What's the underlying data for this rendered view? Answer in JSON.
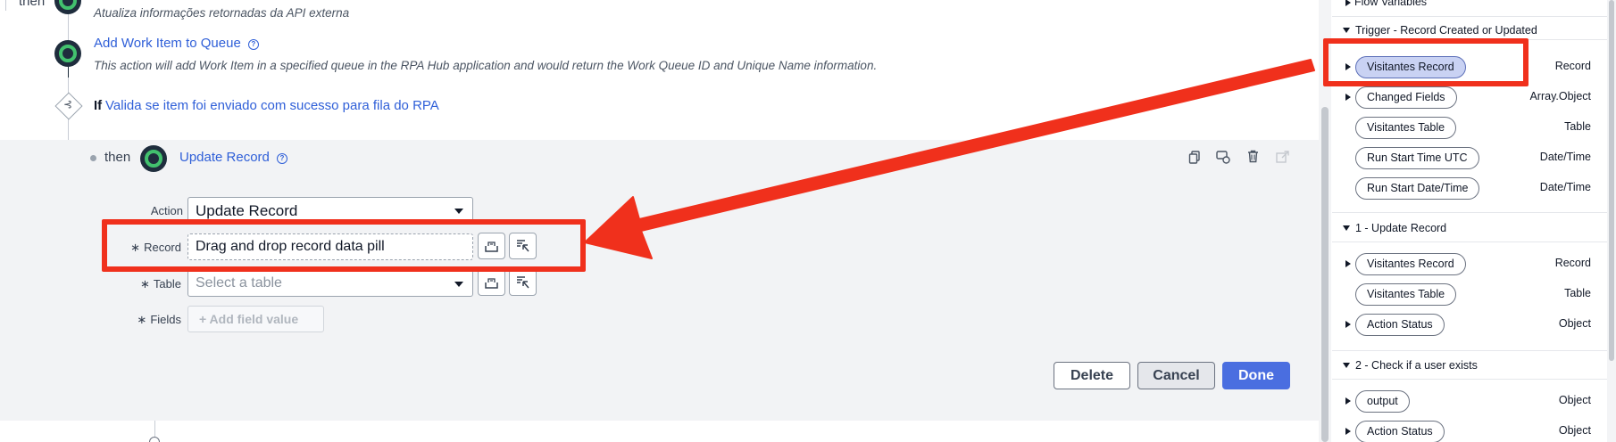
{
  "flow": {
    "top_then_label": "then",
    "top_desc": "Atualiza informações retornadas da API externa",
    "step_add_work_item": {
      "title": "Add Work Item to Queue",
      "desc": "This action will add Work Item in a specified queue in the RPA Hub application and would return the Work Queue ID and Unique Name information."
    },
    "if_step": {
      "keyword": "If",
      "condition": "Valida se item foi enviado com sucesso para fila do RPA"
    },
    "update_step": {
      "then_label": "then",
      "title": "Update Record",
      "toolbar_icons": [
        "copy-icon",
        "comment-icon",
        "trash-icon",
        "open-external-icon"
      ],
      "fields": {
        "action_label": "Action",
        "action_value": "Update Record",
        "record_label": "Record",
        "record_placeholder": "Drag and drop record data pill",
        "table_label": "Table",
        "table_placeholder": "Select a table",
        "fields_label": "Fields",
        "add_field_label": "+ Add field value"
      },
      "buttons": {
        "delete": "Delete",
        "cancel": "Cancel",
        "done": "Done"
      }
    }
  },
  "data_panel": {
    "flow_variables": "Flow Variables",
    "sections": [
      {
        "title": "Trigger - Record Created or Updated",
        "pills": [
          {
            "label": "Visitantes Record",
            "type": "Record",
            "expandable": true,
            "selected": true
          },
          {
            "label": "Changed Fields",
            "type": "Array.Object",
            "expandable": true,
            "selected": false
          },
          {
            "label": "Visitantes Table",
            "type": "Table",
            "expandable": false,
            "selected": false
          },
          {
            "label": "Run Start Time UTC",
            "type": "Date/Time",
            "expandable": false,
            "selected": false
          },
          {
            "label": "Run Start Date/Time",
            "type": "Date/Time",
            "expandable": false,
            "selected": false
          }
        ]
      },
      {
        "title": "1 - Update Record",
        "pills": [
          {
            "label": "Visitantes Record",
            "type": "Record",
            "expandable": true,
            "selected": false
          },
          {
            "label": "Visitantes Table",
            "type": "Table",
            "expandable": false,
            "selected": false
          },
          {
            "label": "Action Status",
            "type": "Object",
            "expandable": true,
            "selected": false
          }
        ]
      },
      {
        "title": "2 - Check if a user exists",
        "pills": [
          {
            "label": "output",
            "type": "Object",
            "expandable": true,
            "selected": false
          },
          {
            "label": "Action Status",
            "type": "Object",
            "expandable": true,
            "selected": false
          }
        ]
      }
    ]
  },
  "colors": {
    "annotation_red": "#f0301c",
    "link_blue": "#2f5fd8",
    "done_blue": "#4a6ee0",
    "node_green": "#42c16e",
    "selected_pill": "#c9d2f3"
  }
}
